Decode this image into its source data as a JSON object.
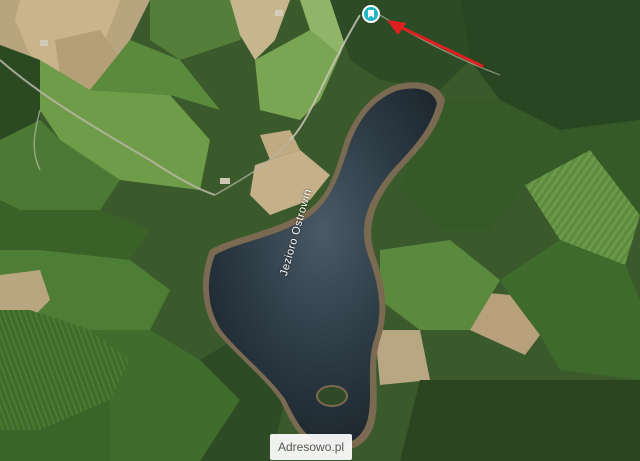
{
  "map": {
    "view": "satellite",
    "lake_label": "Jezioro Ostrowin",
    "marker": {
      "icon": "location-pin-icon",
      "color": "#1fb5c6"
    },
    "arrow": {
      "color": "#e02020"
    },
    "watermark": "Adresowo.pl"
  }
}
